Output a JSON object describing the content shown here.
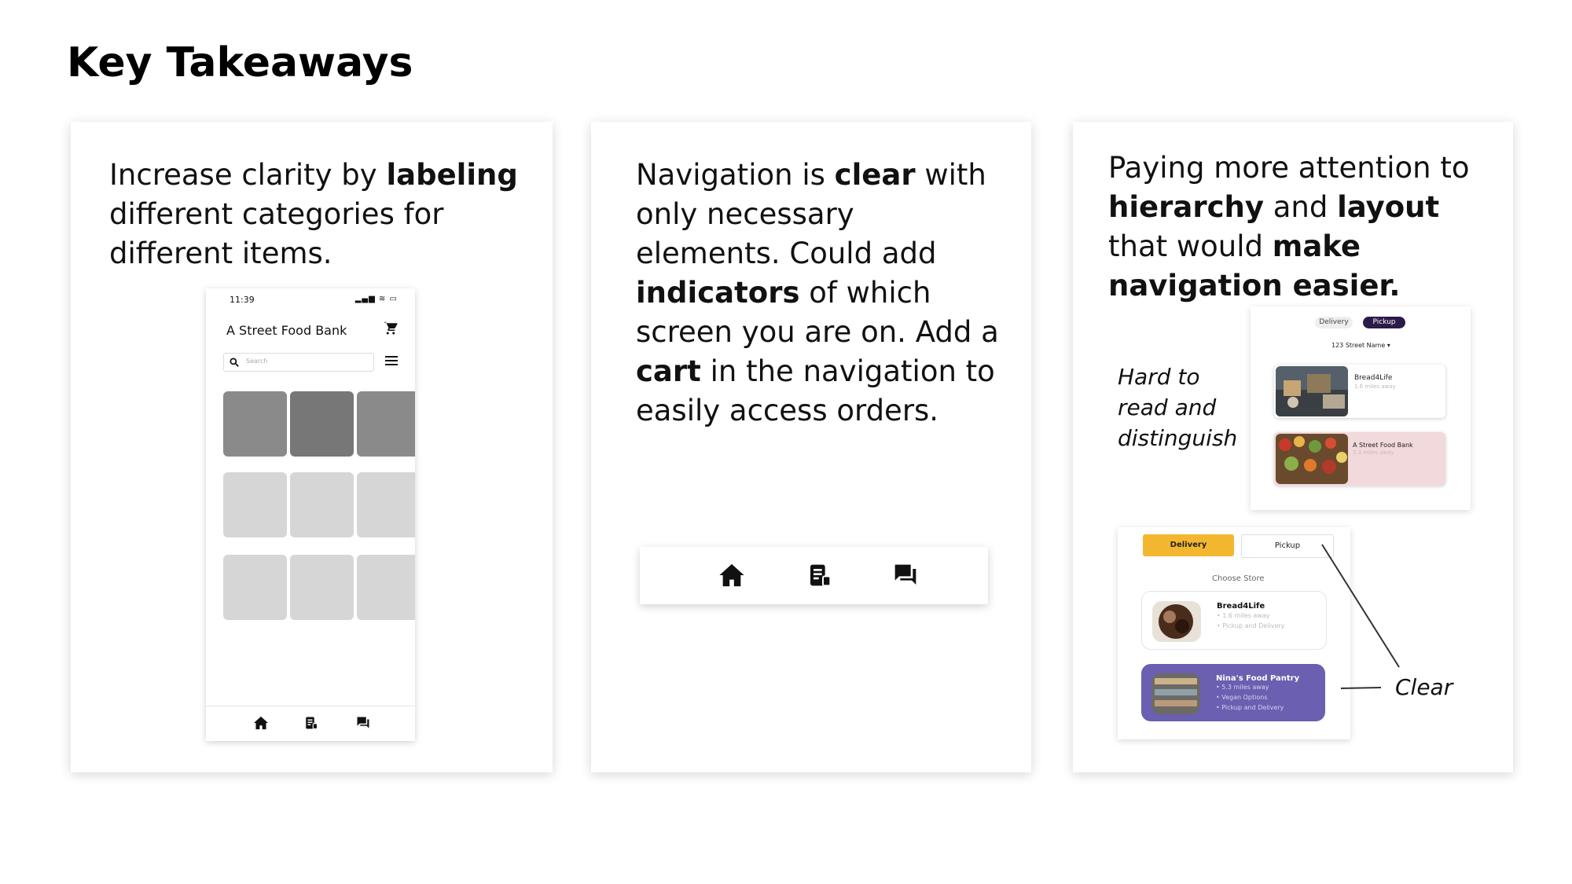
{
  "page": {
    "title": "Key Takeaways"
  },
  "card1": {
    "text": {
      "p1": "Increase clarity by ",
      "b1": "labeling",
      "p2": " different categories for different items."
    },
    "phone": {
      "time": "11:39",
      "status": "▂▄▆ ≋ ▭",
      "title": "A Street Food Bank",
      "search_placeholder": "Search",
      "nav_icons": [
        "home-icon",
        "orders-icon",
        "chat-icon"
      ],
      "tile_colors": [
        "#8a8a8a",
        "#777777",
        "#8a8a8a",
        "#d6d6d6",
        "#d6d6d6",
        "#d6d6d6",
        "#d6d6d6",
        "#d6d6d6",
        "#d6d6d6"
      ]
    }
  },
  "card2": {
    "text": {
      "p1": "Navigation is ",
      "b1": "clear",
      "p2": " with only necessary elements. Could add ",
      "b2": "indicators",
      "p3": " of which screen you are on. Add a ",
      "b3": "cart",
      "p4": " in the navigation to easily access orders."
    },
    "nav_icons": [
      "home-icon",
      "orders-icon",
      "chat-icon"
    ]
  },
  "card3": {
    "text": {
      "p1": "Paying more attention to ",
      "b1": "hierarchy",
      "p2": " and ",
      "b2": "layout",
      "p3": " that would ",
      "b3": "make navigation easier."
    },
    "note_hard": "Hard to read and distinguish",
    "note_clear": "Clear",
    "shot1": {
      "tab_delivery": "Delivery",
      "tab_pickup": "Pickup",
      "address": "123 Street Name ▾",
      "stores": [
        {
          "name": "Bread4Life",
          "distance": "1.6 miles away"
        },
        {
          "name": "A Street Food Bank",
          "distance": "5.3 miles away"
        }
      ]
    },
    "shot2": {
      "tab_delivery": "Delivery",
      "tab_pickup": "Pickup",
      "choose_label": "Choose Store",
      "stores": [
        {
          "name": "Bread4Life",
          "meta1": "• 1.6 miles away",
          "meta2": "• Pickup and Delivery",
          "meta3": ""
        },
        {
          "name": "Nina's Food Pantry",
          "meta1": "• 5.3 miles away",
          "meta2": "• Vegan Options",
          "meta3": "• Pickup and Delivery"
        }
      ]
    }
  },
  "colors": {
    "delivery_yellow": "#f3b72f",
    "pickup_dark": "#2b1a4a",
    "nina_purple": "#6a5fb0",
    "pink_card": "#f2d9db"
  }
}
